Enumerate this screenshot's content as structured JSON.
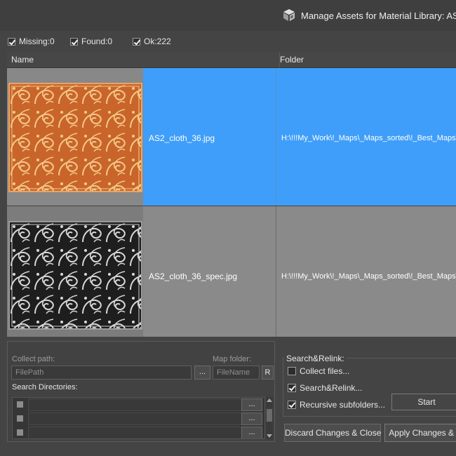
{
  "window": {
    "title": "Manage Assets  for Material Library: AS_v"
  },
  "filters": [
    {
      "label": "Missing:0",
      "checked": true
    },
    {
      "label": "Found:0",
      "checked": true
    },
    {
      "label": "Ok:222",
      "checked": true
    }
  ],
  "table": {
    "columns": [
      "Name",
      "Folder"
    ],
    "rows": [
      {
        "name": "AS2_cloth_36.jpg",
        "folder": "H:\\!!!My_Work\\!_Maps\\_Maps_sorted\\!_Best_Maps\\!",
        "selected": true,
        "thumb": "orange-ornament-texture"
      },
      {
        "name": "AS2_cloth_36_spec.jpg",
        "folder": "H:\\!!!My_Work\\!_Maps\\_Maps_sorted\\!_Best_Maps\\",
        "selected": false,
        "thumb": "grey-ornament-texture"
      }
    ]
  },
  "collect": {
    "collect_path_label": "Collect path:",
    "collect_path_placeholder": "FilePath",
    "browse_label": "...",
    "map_folder_label": "Map folder:",
    "map_folder_placeholder": "FileName",
    "r_label": "R",
    "search_dirs_label": "Search Directories:",
    "dir_rows": [
      {
        "btn": "..."
      },
      {
        "btn": "..."
      },
      {
        "btn": "..."
      }
    ]
  },
  "relink": {
    "group_title": "Search&Relink:",
    "options": [
      {
        "label": "Collect files...",
        "checked": false
      },
      {
        "label": "Search&Relink...",
        "checked": true
      },
      {
        "label": "Recursive subfolders...",
        "checked": true
      }
    ],
    "start_label": "Start"
  },
  "buttons": {
    "discard": "Discard Changes & Close",
    "apply": "Apply Changes & C"
  },
  "colors": {
    "selection": "#3f9ef9",
    "background": "#444444"
  }
}
